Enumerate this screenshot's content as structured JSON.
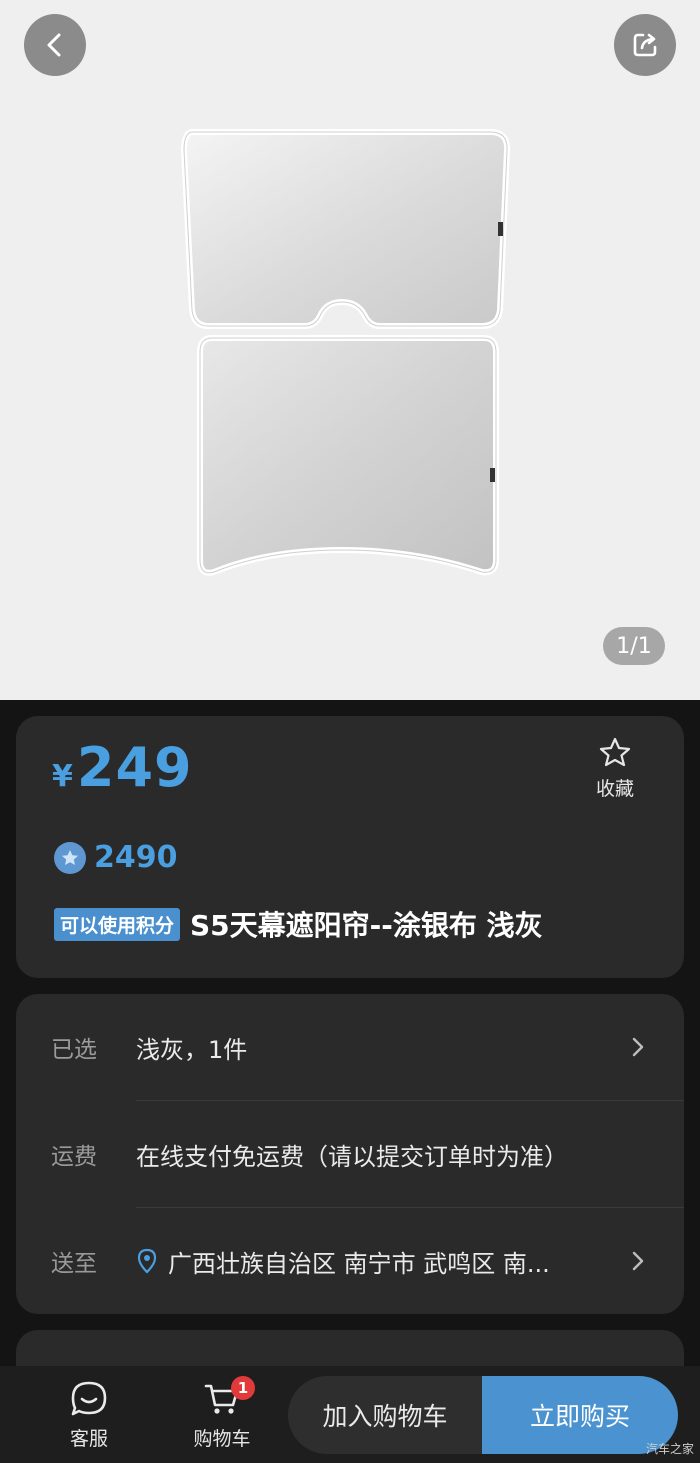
{
  "hero": {
    "page_indicator": "1/1",
    "back_icon": "chevron-left-icon",
    "share_icon": "share-icon"
  },
  "price": {
    "symbol": "¥",
    "amount": "249"
  },
  "favorite": {
    "icon": "star-icon",
    "label": "收藏"
  },
  "points": {
    "icon": "points-star-icon",
    "value": "2490"
  },
  "product": {
    "tag": "可以使用积分",
    "title": "S5天幕遮阳帘--涂银布 浅灰"
  },
  "info": {
    "selected_label": "已选",
    "selected_value": "浅灰，1件",
    "shipping_label": "运费",
    "shipping_value": "在线支付免运费（请以提交订单时为准）",
    "deliver_label": "送至",
    "deliver_value": "广西壮族自治区 南宁市 武鸣区 南..."
  },
  "bottom_bar": {
    "service_label": "客服",
    "cart_label": "购物车",
    "cart_badge": "1",
    "add_to_cart": "加入购物车",
    "buy_now": "立即购买"
  },
  "watermark": "汽车之家",
  "colors": {
    "accent_blue": "#4a9fe0",
    "buy_button": "#4a93d0",
    "badge_red": "#e23a3a",
    "card_bg": "#2a2a2a"
  }
}
